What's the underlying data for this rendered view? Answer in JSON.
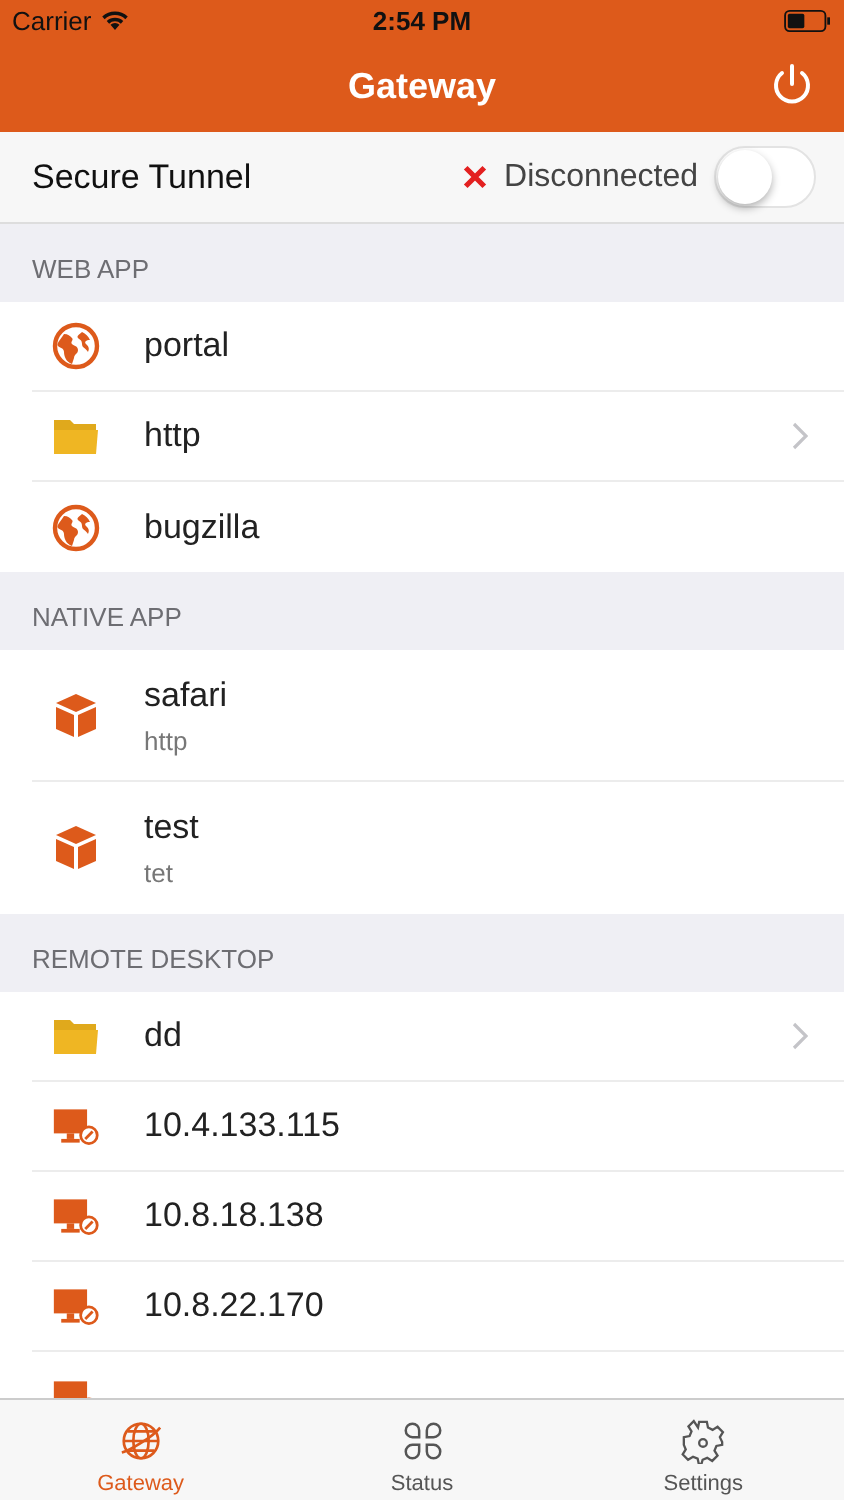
{
  "status_bar": {
    "carrier": "Carrier",
    "time": "2:54 PM"
  },
  "nav": {
    "title": "Gateway"
  },
  "tunnel": {
    "label": "Secure Tunnel",
    "status": "Disconnected",
    "on": false
  },
  "sections": [
    {
      "title": "WEB APP",
      "items": [
        {
          "kind": "globe",
          "title": "portal",
          "disclosure": false
        },
        {
          "kind": "folder",
          "title": "http",
          "disclosure": true
        },
        {
          "kind": "globe",
          "title": "bugzilla",
          "disclosure": false
        }
      ]
    },
    {
      "title": "NATIVE APP",
      "items": [
        {
          "kind": "box",
          "title": "safari",
          "subtitle": "http",
          "disclosure": false
        },
        {
          "kind": "box",
          "title": "test",
          "subtitle": "tet",
          "disclosure": false
        }
      ]
    },
    {
      "title": "REMOTE DESKTOP",
      "items": [
        {
          "kind": "folder",
          "title": "dd",
          "disclosure": true
        },
        {
          "kind": "desktop",
          "title": "10.4.133.115",
          "disclosure": false
        },
        {
          "kind": "desktop",
          "title": "10.8.18.138",
          "disclosure": false
        },
        {
          "kind": "desktop",
          "title": "10.8.22.170",
          "disclosure": false
        },
        {
          "kind": "desktop",
          "disclosure": false
        }
      ]
    }
  ],
  "tabs": [
    {
      "kind": "globe",
      "label": "Gateway",
      "selected": true
    },
    {
      "kind": "status",
      "label": "Status",
      "selected": false
    },
    {
      "kind": "gear",
      "label": "Settings",
      "selected": false
    }
  ]
}
